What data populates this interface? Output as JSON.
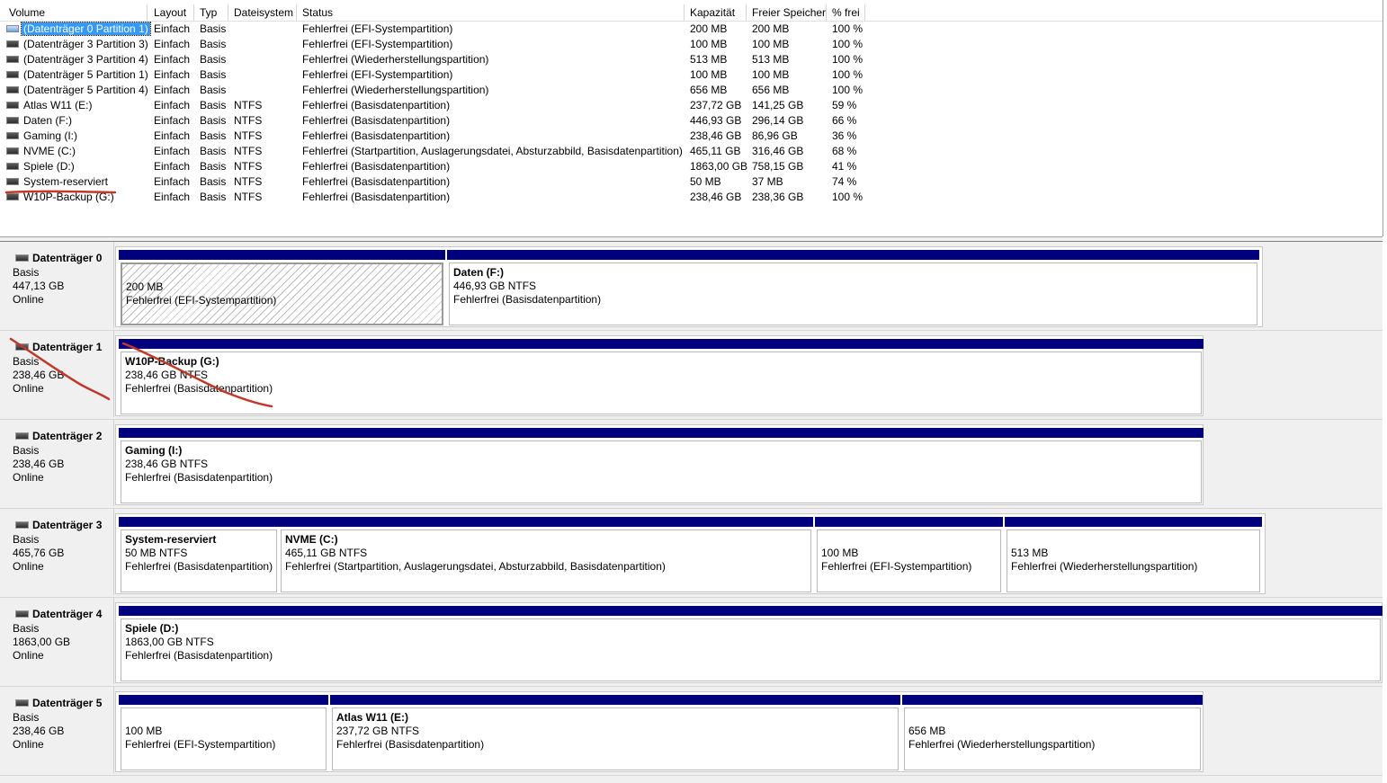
{
  "volume_list": {
    "columns": [
      "Volume",
      "Layout",
      "Typ",
      "Dateisystem",
      "Status",
      "Kapazität",
      "Freier Speicher",
      "% frei"
    ],
    "rows": [
      {
        "volume": "(Datenträger 0 Partition 1)",
        "layout": "Einfach",
        "typ": "Basis",
        "fs": "",
        "status": "Fehlerfrei (EFI-Systempartition)",
        "kapazitaet": "200 MB",
        "frei": "200 MB",
        "prozent": "100 %"
      },
      {
        "volume": "(Datenträger 3 Partition 3)",
        "layout": "Einfach",
        "typ": "Basis",
        "fs": "",
        "status": "Fehlerfrei (EFI-Systempartition)",
        "kapazitaet": "100 MB",
        "frei": "100 MB",
        "prozent": "100 %"
      },
      {
        "volume": "(Datenträger 3 Partition 4)",
        "layout": "Einfach",
        "typ": "Basis",
        "fs": "",
        "status": "Fehlerfrei (Wiederherstellungspartition)",
        "kapazitaet": "513 MB",
        "frei": "513 MB",
        "prozent": "100 %"
      },
      {
        "volume": "(Datenträger 5 Partition 1)",
        "layout": "Einfach",
        "typ": "Basis",
        "fs": "",
        "status": "Fehlerfrei (EFI-Systempartition)",
        "kapazitaet": "100 MB",
        "frei": "100 MB",
        "prozent": "100 %"
      },
      {
        "volume": "(Datenträger 5 Partition 4)",
        "layout": "Einfach",
        "typ": "Basis",
        "fs": "",
        "status": "Fehlerfrei (Wiederherstellungspartition)",
        "kapazitaet": "656 MB",
        "frei": "656 MB",
        "prozent": "100 %"
      },
      {
        "volume": "Atlas W11 (E:)",
        "layout": "Einfach",
        "typ": "Basis",
        "fs": "NTFS",
        "status": "Fehlerfrei (Basisdatenpartition)",
        "kapazitaet": "237,72 GB",
        "frei": "141,25 GB",
        "prozent": "59 %"
      },
      {
        "volume": "Daten (F:)",
        "layout": "Einfach",
        "typ": "Basis",
        "fs": "NTFS",
        "status": "Fehlerfrei (Basisdatenpartition)",
        "kapazitaet": "446,93 GB",
        "frei": "296,14 GB",
        "prozent": "66 %"
      },
      {
        "volume": "Gaming (I:)",
        "layout": "Einfach",
        "typ": "Basis",
        "fs": "NTFS",
        "status": "Fehlerfrei (Basisdatenpartition)",
        "kapazitaet": "238,46 GB",
        "frei": "86,96 GB",
        "prozent": "36 %"
      },
      {
        "volume": "NVME (C:)",
        "layout": "Einfach",
        "typ": "Basis",
        "fs": "NTFS",
        "status": "Fehlerfrei (Startpartition, Auslagerungsdatei, Absturzabbild, Basisdatenpartition)",
        "kapazitaet": "465,11 GB",
        "frei": "316,46 GB",
        "prozent": "68 %"
      },
      {
        "volume": "Spiele (D:)",
        "layout": "Einfach",
        "typ": "Basis",
        "fs": "NTFS",
        "status": "Fehlerfrei (Basisdatenpartition)",
        "kapazitaet": "1863,00 GB",
        "frei": "758,15 GB",
        "prozent": "41 %"
      },
      {
        "volume": "System-reserviert",
        "layout": "Einfach",
        "typ": "Basis",
        "fs": "NTFS",
        "status": "Fehlerfrei (Basisdatenpartition)",
        "kapazitaet": "50 MB",
        "frei": "37 MB",
        "prozent": "74 %"
      },
      {
        "volume": "W10P-Backup (G:)",
        "layout": "Einfach",
        "typ": "Basis",
        "fs": "NTFS",
        "status": "Fehlerfrei (Basisdatenpartition)",
        "kapazitaet": "238,46 GB",
        "frei": "238,36 GB",
        "prozent": "100 %"
      }
    ],
    "selected_row": 0
  },
  "disks": [
    {
      "name": "Datenträger 0",
      "type": "Basis",
      "size": "447,13 GB",
      "status": "Online",
      "partitions": [
        {
          "name": "",
          "size": "200 MB",
          "status": "Fehlerfrei (EFI-Systempartition)",
          "hatched": true
        },
        {
          "name": "Daten  (F:)",
          "size": "446,93 GB NTFS",
          "status": "Fehlerfrei (Basisdatenpartition)"
        }
      ]
    },
    {
      "name": "Datenträger 1",
      "type": "Basis",
      "size": "238,46 GB",
      "status": "Online",
      "partitions": [
        {
          "name": "W10P-Backup  (G:)",
          "size": "238,46 GB NTFS",
          "status": "Fehlerfrei (Basisdatenpartition)"
        }
      ]
    },
    {
      "name": "Datenträger 2",
      "type": "Basis",
      "size": "238,46 GB",
      "status": "Online",
      "partitions": [
        {
          "name": "Gaming  (I:)",
          "size": "238,46 GB NTFS",
          "status": "Fehlerfrei (Basisdatenpartition)"
        }
      ]
    },
    {
      "name": "Datenträger 3",
      "type": "Basis",
      "size": "465,76 GB",
      "status": "Online",
      "partitions": [
        {
          "name": "System-reserviert",
          "size": "50 MB NTFS",
          "status": "Fehlerfrei (Basisdatenpartition)"
        },
        {
          "name": "NVME  (C:)",
          "size": "465,11 GB NTFS",
          "status": "Fehlerfrei (Startpartition, Auslagerungsdatei, Absturzabbild, Basisdatenpartition)"
        },
        {
          "name": "",
          "size": "100 MB",
          "status": "Fehlerfrei (EFI-Systempartition)"
        },
        {
          "name": "",
          "size": "513 MB",
          "status": "Fehlerfrei (Wiederherstellungspartition)"
        }
      ]
    },
    {
      "name": "Datenträger 4",
      "type": "Basis",
      "size": "1863,00 GB",
      "status": "Online",
      "partitions": [
        {
          "name": "Spiele  (D:)",
          "size": "1863,00 GB NTFS",
          "status": "Fehlerfrei (Basisdatenpartition)"
        }
      ]
    },
    {
      "name": "Datenträger 5",
      "type": "Basis",
      "size": "238,46 GB",
      "status": "Online",
      "partitions": [
        {
          "name": "",
          "size": "100 MB",
          "status": "Fehlerfrei (EFI-Systempartition)"
        },
        {
          "name": "Atlas W11  (E:)",
          "size": "237,72 GB NTFS",
          "status": "Fehlerfrei (Basisdatenpartition)"
        },
        {
          "name": "",
          "size": "656 MB",
          "status": "Fehlerfrei (Wiederherstellungspartition)"
        }
      ]
    }
  ],
  "colors": {
    "partition_bar": "#00007f",
    "selection": "#3399ff",
    "annotation": "#c0392b"
  }
}
